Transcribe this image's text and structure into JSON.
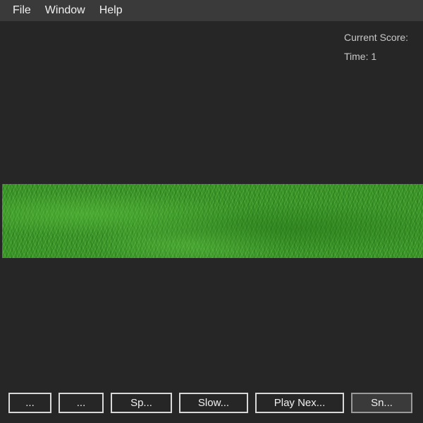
{
  "menubar": {
    "items": [
      "File",
      "Window",
      "Help"
    ]
  },
  "hud": {
    "score_label": "Current Score:",
    "time_label": "Time: 1"
  },
  "playfield": {
    "terrain": "grass",
    "color": "#3f9a2c"
  },
  "toolbar": {
    "buttons": [
      "...",
      "...",
      "Sp...",
      "Slow...",
      "Play Nex...",
      "Sn..."
    ],
    "selected_index": 5
  }
}
